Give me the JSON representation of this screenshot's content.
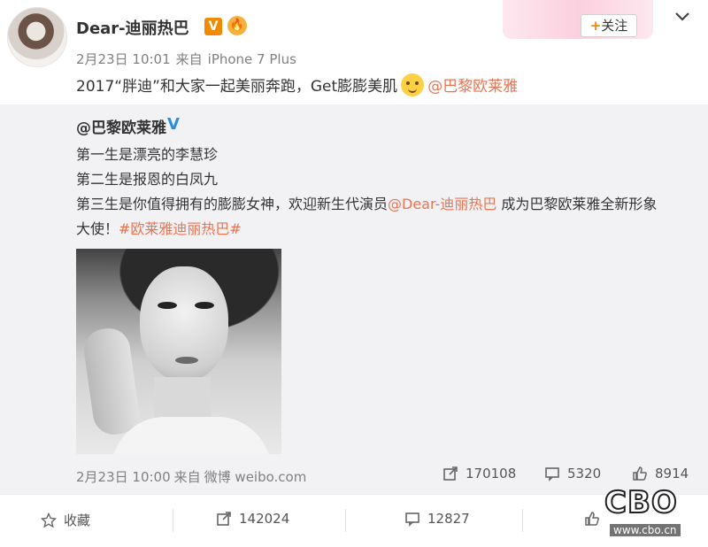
{
  "header": {
    "author_name": "Dear-迪丽热巴",
    "verified_badge": "V",
    "badge2_glyph": "🔥",
    "time": "2月23日 10:01",
    "source_prefix": "来自",
    "source": "iPhone 7 Plus",
    "follow_label": "关注",
    "follow_plus": "+"
  },
  "post": {
    "text": "2017“胖迪”和大家一起美丽奔跑，Get膨膨美肌",
    "mention": "@巴黎欧莱雅"
  },
  "repost": {
    "author": "@巴黎欧莱雅",
    "verified_mark": "V",
    "line1": "第一生是漂亮的李慧珍",
    "line2": "第二生是报恩的白凤九",
    "line3_pre": "第三生是你值得拥有的膨膨女神，欢迎新生代演员",
    "line3_mention": "@Dear-迪丽热巴",
    "line3_post": " 成为巴黎欧莱雅全新形象",
    "line4_pre": "大使！",
    "line4_tag": "#欧莱雅迪丽热巴#",
    "time": "2月23日 10:00",
    "source_prefix": "来自",
    "source": "微博 weibo.com",
    "stats": {
      "reposts": "170108",
      "comments": "5320",
      "likes": "8914"
    }
  },
  "footer": {
    "favorite_label": "收藏",
    "repost_count": "142024",
    "comment_count": "12827",
    "like_count": ""
  },
  "watermark": {
    "logo": "CBO",
    "url": "www.cbo.cn"
  },
  "colors": {
    "link": "#eb7350",
    "verified_orange": "#f08a00",
    "verified_blue": "#2a8fe0",
    "repost_bg": "#f2f2f5"
  }
}
